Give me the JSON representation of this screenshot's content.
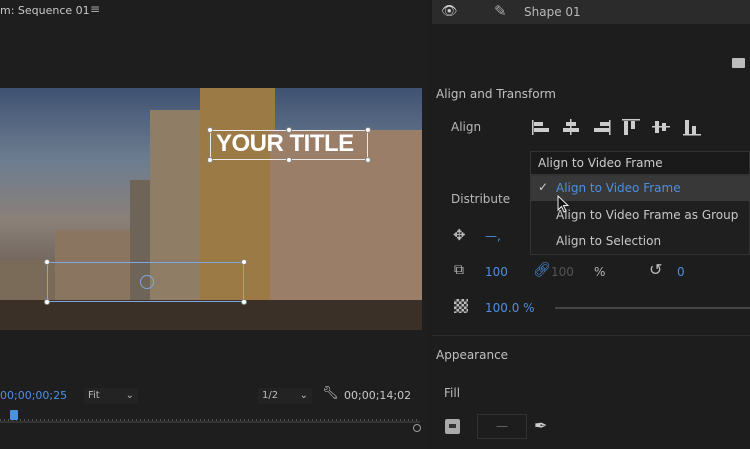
{
  "monitor": {
    "title": "m: Sequence 01",
    "menu_icon": "hamburger-icon",
    "title_text": "YOUR TITLE",
    "timecode_current": "00;00;00;25",
    "zoom": "Fit",
    "resolution": "1/2",
    "timecode_duration": "00;00;14;02"
  },
  "layers": {
    "name": "Shape 01"
  },
  "align_transform": {
    "heading": "Align and Transform",
    "align_label": "Align",
    "distribute_label": "Distribute",
    "dropdown_value": "Align to Video Frame",
    "menu_items": [
      {
        "label": "Align to Video Frame",
        "checked": true
      },
      {
        "label": "Align to Video Frame as Group",
        "checked": false
      },
      {
        "label": "Align to Selection",
        "checked": false
      }
    ],
    "position_value": "—,",
    "scale": "100",
    "scale_height": "100",
    "percent": "%",
    "rotation": "0",
    "opacity": "100.0 %"
  },
  "appearance": {
    "heading": "Appearance",
    "fill_label": "Fill",
    "fill_value": "—"
  },
  "colors": {
    "accent": "#4d8fe0"
  }
}
